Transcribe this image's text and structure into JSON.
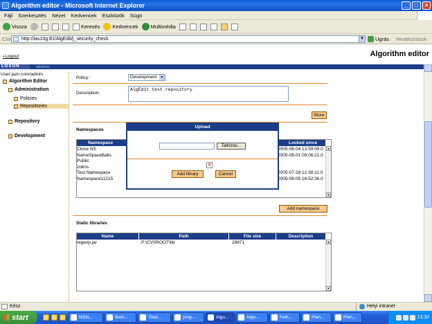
{
  "window": {
    "title": "Algorithm editor - Microsoft Internet Explorer"
  },
  "menu": [
    "Fájl",
    "Szerkesztés",
    "Nézet",
    "Kedvencek",
    "Eszközök",
    "Súgó"
  ],
  "toolbar": {
    "back": "Vissza",
    "search": "Keresés",
    "favorites": "Kedvencek",
    "media": "Multimédia"
  },
  "address": {
    "label": "Cím",
    "url": "http://ias10g:81/AlgEdit/j_security_check",
    "go": "Ugrás",
    "links": "Hivatkozások"
  },
  "page": {
    "logout": "Logout",
    "app_title": "Algorithm editor",
    "logo": "LOXON",
    "logo_sub": "solutions",
    "user": "User:jazn.com/admin"
  },
  "tree": {
    "root": "Algorithm Editor",
    "administration": "Administration",
    "policies": "Policies",
    "repositories": "Repositories",
    "repository": "Repository",
    "development": "Development"
  },
  "form": {
    "policy_label": "Policy:",
    "policy_value": "Development",
    "description_label": "Description:",
    "description_value": "AlgEdit test repository",
    "store": "Store"
  },
  "namespaces": {
    "section": "Namespaces",
    "col_namespace": "Namespace",
    "col_locked": "Locked since",
    "rows": [
      {
        "name": "Clone NS",
        "locked": "2005-08-04 13:59:09.0"
      },
      {
        "name": "NameSpaceBalls",
        "locked": "2005-08-01 09:06:21.0"
      },
      {
        "name": "Public",
        "locked": ""
      },
      {
        "name": "zokns",
        "locked": ""
      },
      {
        "name": "Test.Namespace",
        "locked": "2005-07-28 12:38:11.0"
      },
      {
        "name": "Namespace11215",
        "locked": "2005-08-05 16:52:36.0"
      }
    ],
    "add_button": "Add namespace"
  },
  "libraries": {
    "section": "Static libraries",
    "cols": [
      "Name",
      "Path",
      "File size",
      "Description"
    ],
    "rows": [
      {
        "name": "regexp.jar",
        "path": "P:\\CVSROOT\\lib",
        "size": "29871",
        "description": ""
      }
    ]
  },
  "dialog": {
    "title": "Upload",
    "browse": "Tallózás...",
    "add": "Add library",
    "cancel": "Cancel"
  },
  "status": {
    "left": "Kész",
    "zone": "Helyi intranet"
  },
  "taskbar": {
    "start": "start",
    "tasks": [
      "MSN...",
      "Beér...",
      "Total...",
      "[orig...",
      "Algo...",
      "Alge...",
      "Felh...",
      "Plan...",
      "Plan..."
    ],
    "clock": "13:32"
  }
}
